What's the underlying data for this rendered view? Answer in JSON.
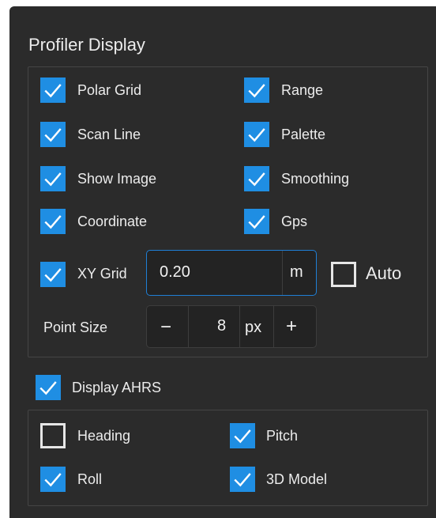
{
  "profiler": {
    "title": "Profiler Display",
    "items": [
      {
        "label": "Polar Grid",
        "checked": true
      },
      {
        "label": "Range",
        "checked": true
      },
      {
        "label": "Scan Line",
        "checked": true
      },
      {
        "label": "Palette",
        "checked": true
      },
      {
        "label": "Show Image",
        "checked": true
      },
      {
        "label": "Smoothing",
        "checked": true
      },
      {
        "label": "Coordinate",
        "checked": true
      },
      {
        "label": "Gps",
        "checked": true
      }
    ],
    "xy_grid": {
      "label": "XY Grid",
      "checked": true,
      "value": "0.20",
      "unit": "m"
    },
    "auto": {
      "label": "Auto",
      "checked": false
    },
    "point_size": {
      "label": "Point Size",
      "minus": "−",
      "value": "8",
      "unit": "px",
      "plus": "+"
    }
  },
  "ahrs": {
    "label": "Display AHRS",
    "checked": true,
    "items": [
      {
        "label": "Heading",
        "checked": false
      },
      {
        "label": "Pitch",
        "checked": true
      },
      {
        "label": "Roll",
        "checked": true
      },
      {
        "label": "3D Model",
        "checked": true
      }
    ]
  },
  "colors": {
    "accent": "#1f8ee3",
    "panel_bg": "#2b2b2b",
    "text": "#ececec",
    "group_border": "#454545"
  },
  "icons": {
    "checked": "checkmark-icon",
    "unchecked": "empty-box"
  }
}
